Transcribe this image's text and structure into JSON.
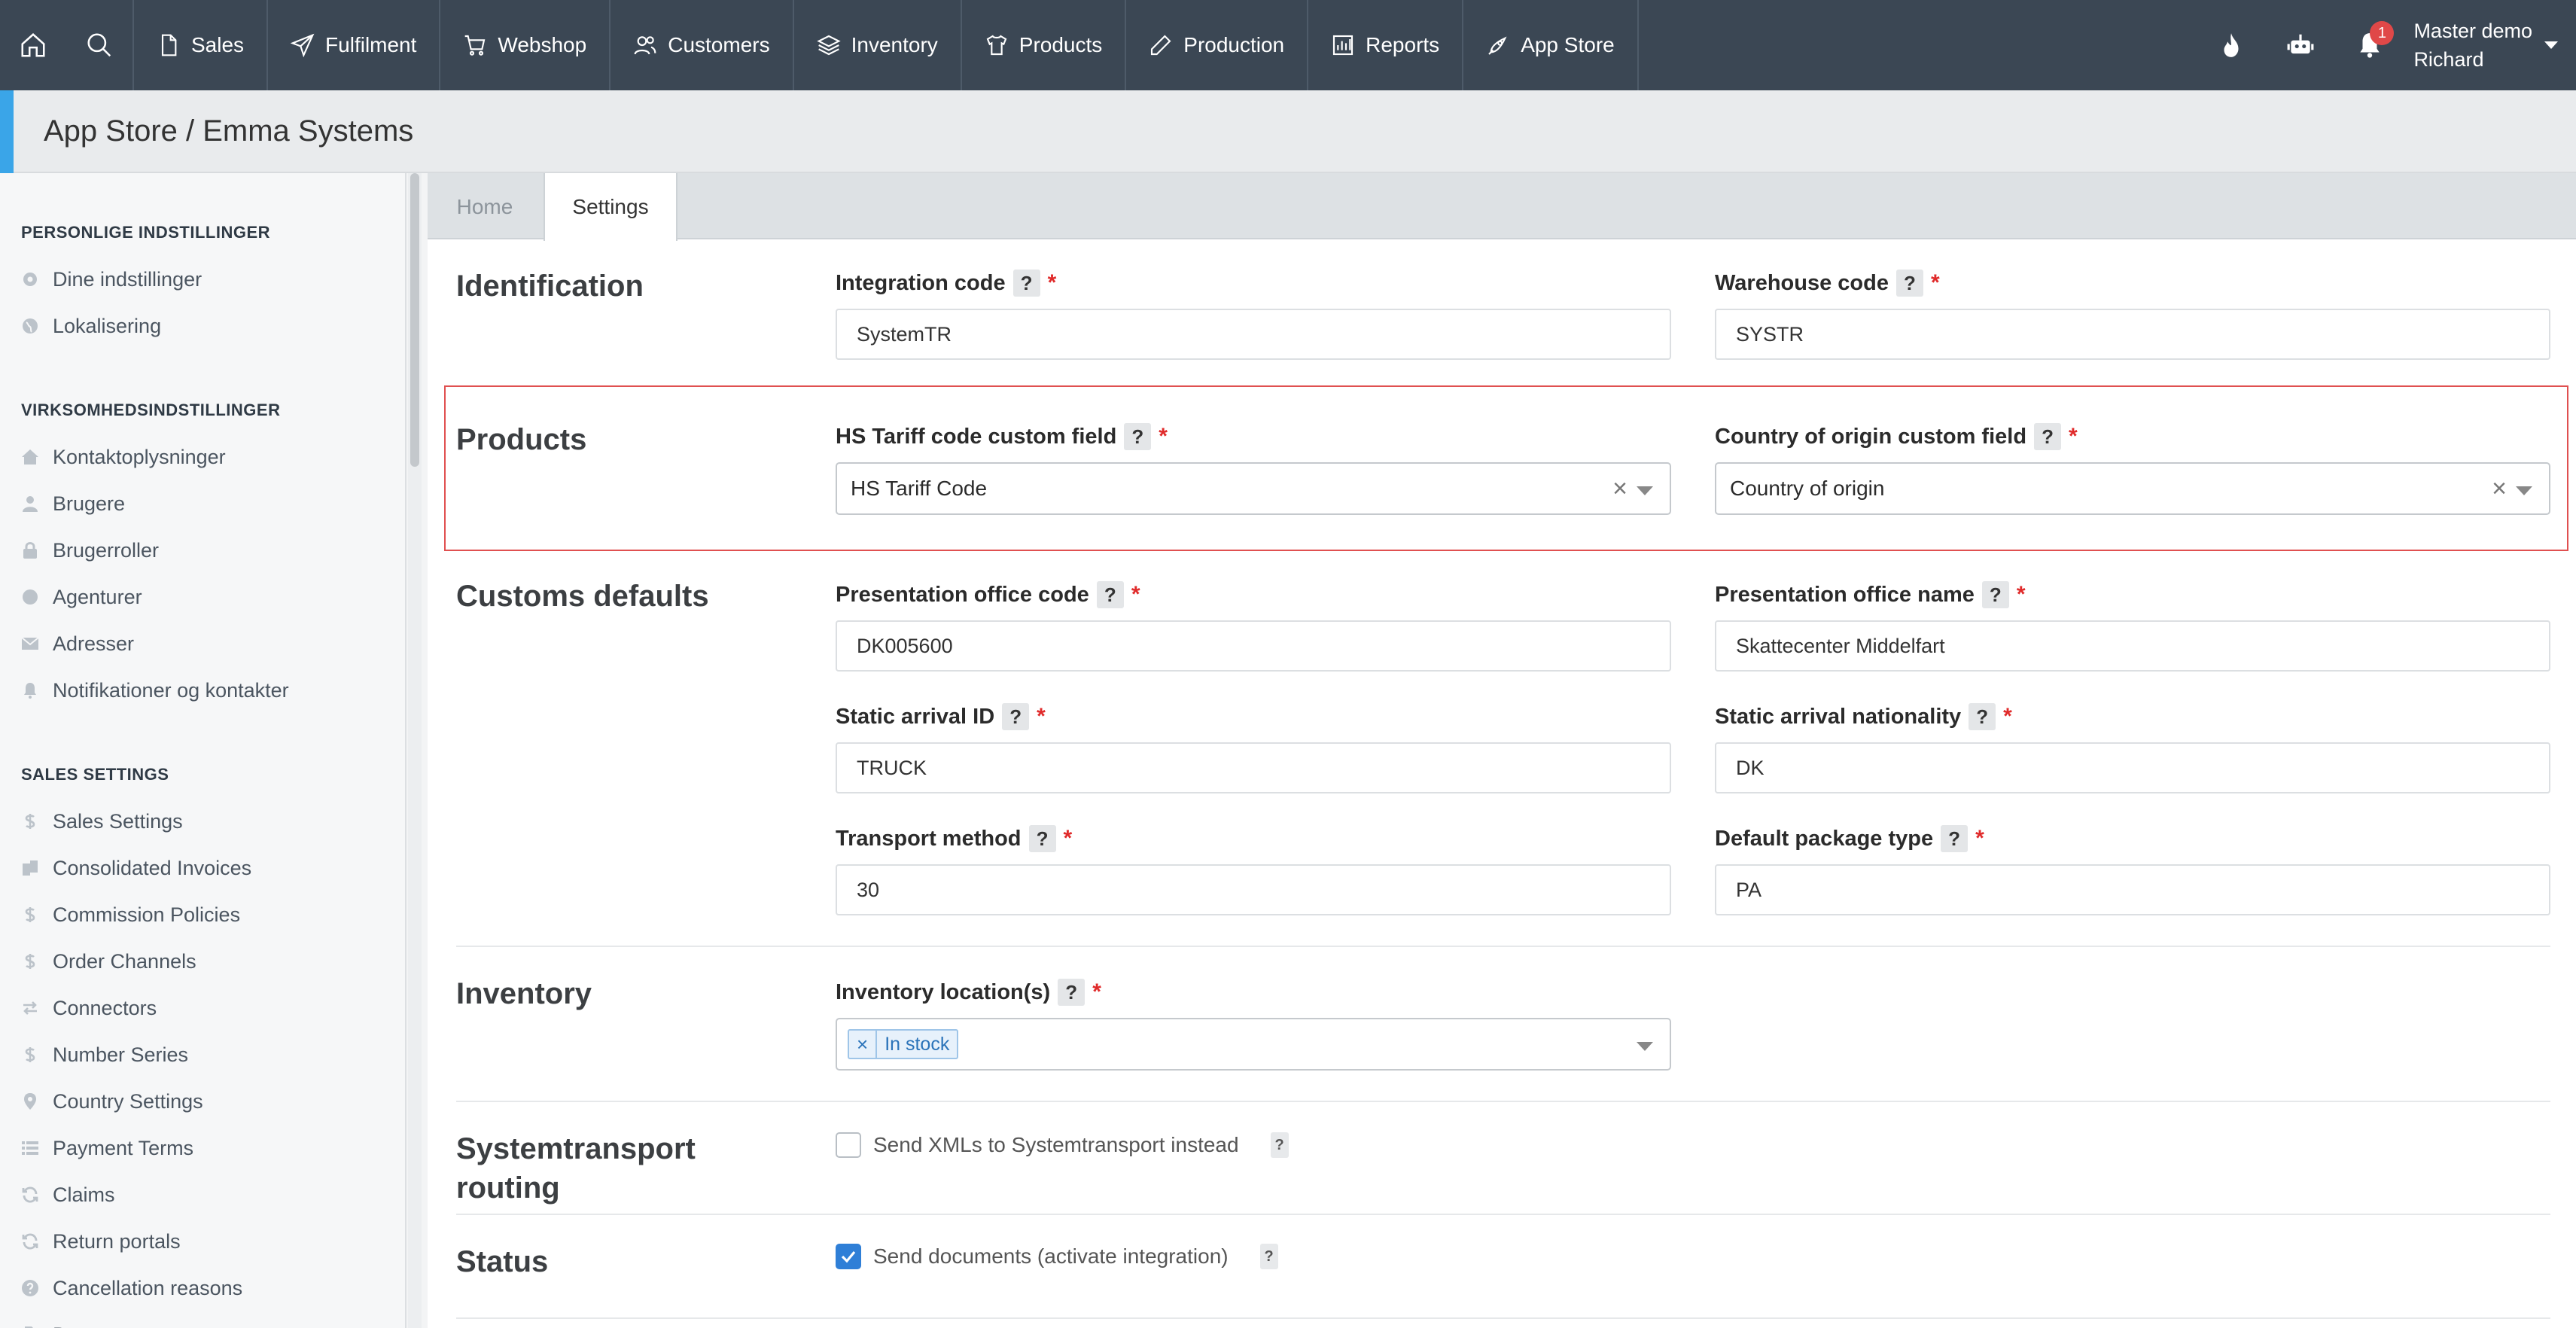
{
  "nav": {
    "items": [
      {
        "label": "Sales",
        "icon": "document-icon"
      },
      {
        "label": "Fulfilment",
        "icon": "send-icon"
      },
      {
        "label": "Webshop",
        "icon": "cart-icon"
      },
      {
        "label": "Customers",
        "icon": "users-icon"
      },
      {
        "label": "Inventory",
        "icon": "layers-icon"
      },
      {
        "label": "Products",
        "icon": "shirt-icon"
      },
      {
        "label": "Production",
        "icon": "pencil-icon"
      },
      {
        "label": "Reports",
        "icon": "report-icon"
      },
      {
        "label": "App Store",
        "icon": "rocket-icon"
      }
    ],
    "notification_count": "1",
    "user_line1": "Master demo",
    "user_line2": "Richard"
  },
  "page_title": "App Store / Emma Systems",
  "sidebar": {
    "sections": [
      {
        "title": "PERSONLIGE INDSTILLINGER",
        "items": [
          {
            "label": "Dine indstillinger",
            "icon": "gear-icon"
          },
          {
            "label": "Lokalisering",
            "icon": "globe-icon"
          }
        ]
      },
      {
        "title": "VIRKSOMHEDSINDSTILLINGER",
        "items": [
          {
            "label": "Kontaktoplysninger",
            "icon": "home-icon"
          },
          {
            "label": "Brugere",
            "icon": "user-icon"
          },
          {
            "label": "Brugerroller",
            "icon": "lock-icon"
          },
          {
            "label": "Agenturer",
            "icon": "circle-icon"
          },
          {
            "label": "Adresser",
            "icon": "envelope-icon"
          },
          {
            "label": "Notifikationer og kontakter",
            "icon": "bell-icon"
          }
        ]
      },
      {
        "title": "SALES SETTINGS",
        "items": [
          {
            "label": "Sales Settings",
            "icon": "dollar-icon"
          },
          {
            "label": "Consolidated Invoices",
            "icon": "files-icon"
          },
          {
            "label": "Commission Policies",
            "icon": "dollar-icon"
          },
          {
            "label": "Order Channels",
            "icon": "dollar-icon"
          },
          {
            "label": "Connectors",
            "icon": "arrows-icon"
          },
          {
            "label": "Number Series",
            "icon": "dollar-icon"
          },
          {
            "label": "Country Settings",
            "icon": "pin-icon"
          },
          {
            "label": "Payment Terms",
            "icon": "list-icon"
          },
          {
            "label": "Claims",
            "icon": "refresh-icon"
          },
          {
            "label": "Return portals",
            "icon": "refresh-icon"
          },
          {
            "label": "Cancellation reasons",
            "icon": "question-circle-icon"
          },
          {
            "label": "Documents",
            "icon": "file-icon"
          }
        ]
      }
    ]
  },
  "tabs": {
    "home": "Home",
    "settings": "Settings"
  },
  "form": {
    "help_glyph": "?",
    "required_glyph": "*",
    "clear_glyph": "×",
    "identification": {
      "title": "Identification",
      "integration_code": {
        "label": "Integration code",
        "value": "SystemTR"
      },
      "warehouse_code": {
        "label": "Warehouse code",
        "value": "SYSTR"
      }
    },
    "products": {
      "title": "Products",
      "hs_tariff": {
        "label": "HS Tariff code custom field",
        "value": "HS Tariff Code"
      },
      "country_origin": {
        "label": "Country of origin custom field",
        "value": "Country of origin"
      }
    },
    "customs": {
      "title": "Customs defaults",
      "presentation_office_code": {
        "label": "Presentation office code",
        "value": "DK005600"
      },
      "presentation_office_name": {
        "label": "Presentation office name",
        "value": "Skattecenter Middelfart"
      },
      "static_arrival_id": {
        "label": "Static arrival ID",
        "value": "TRUCK"
      },
      "static_arrival_nationality": {
        "label": "Static arrival nationality",
        "value": "DK"
      },
      "transport_method": {
        "label": "Transport method",
        "value": "30"
      },
      "default_package_type": {
        "label": "Default package type",
        "value": "PA"
      }
    },
    "inventory": {
      "title": "Inventory",
      "locations": {
        "label": "Inventory location(s)",
        "tag": "In stock"
      }
    },
    "routing": {
      "title_line1": "Systemtransport",
      "title_line2": "routing",
      "send_xml": {
        "label": "Send XMLs to Systemtransport instead",
        "checked": false
      }
    },
    "status": {
      "title": "Status",
      "send_documents": {
        "label": "Send documents (activate integration)",
        "checked": true
      }
    }
  }
}
